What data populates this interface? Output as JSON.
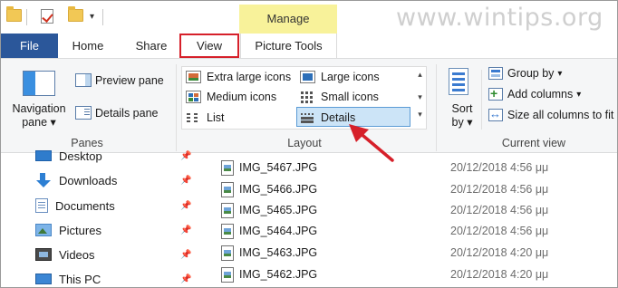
{
  "watermark": "www.wintips.org",
  "manage_label": "Manage",
  "tabs": {
    "file": "File",
    "home": "Home",
    "share": "Share",
    "view": "View",
    "picture_tools": "Picture Tools"
  },
  "panes": {
    "navigation_pane": "Navigation",
    "navigation_pane_2": "pane",
    "preview_pane": "Preview pane",
    "details_pane": "Details pane",
    "group_label": "Panes"
  },
  "layout": {
    "extra_large_icons": "Extra large icons",
    "large_icons": "Large icons",
    "medium_icons": "Medium icons",
    "small_icons": "Small icons",
    "list": "List",
    "details": "Details",
    "group_label": "Layout"
  },
  "current_view": {
    "sort_by_1": "Sort",
    "sort_by_2": "by",
    "group_by": "Group by",
    "add_columns": "Add columns",
    "size_all_columns": "Size all columns to fit",
    "group_label": "Current view"
  },
  "nav_items": [
    {
      "label": "Desktop",
      "icon": "desktop-icon"
    },
    {
      "label": "Downloads",
      "icon": "downloads-icon"
    },
    {
      "label": "Documents",
      "icon": "documents-icon"
    },
    {
      "label": "Pictures",
      "icon": "pictures-icon"
    },
    {
      "label": "Videos",
      "icon": "videos-icon"
    },
    {
      "label": "This PC",
      "icon": "this-pc-icon"
    }
  ],
  "files": [
    {
      "name": "IMG_5467.JPG",
      "date": "20/12/2018 4:56 μμ"
    },
    {
      "name": "IMG_5466.JPG",
      "date": "20/12/2018 4:56 μμ"
    },
    {
      "name": "IMG_5465.JPG",
      "date": "20/12/2018 4:56 μμ"
    },
    {
      "name": "IMG_5464.JPG",
      "date": "20/12/2018 4:56 μμ"
    },
    {
      "name": "IMG_5463.JPG",
      "date": "20/12/2018 4:20 μμ"
    },
    {
      "name": "IMG_5462.JPG",
      "date": "20/12/2018 4:20 μμ"
    }
  ],
  "colors": {
    "file_tab": "#2b579a",
    "manage_bg": "#f8f29a",
    "highlight_red": "#d6202a",
    "selection_blue": "#cce4f7"
  }
}
